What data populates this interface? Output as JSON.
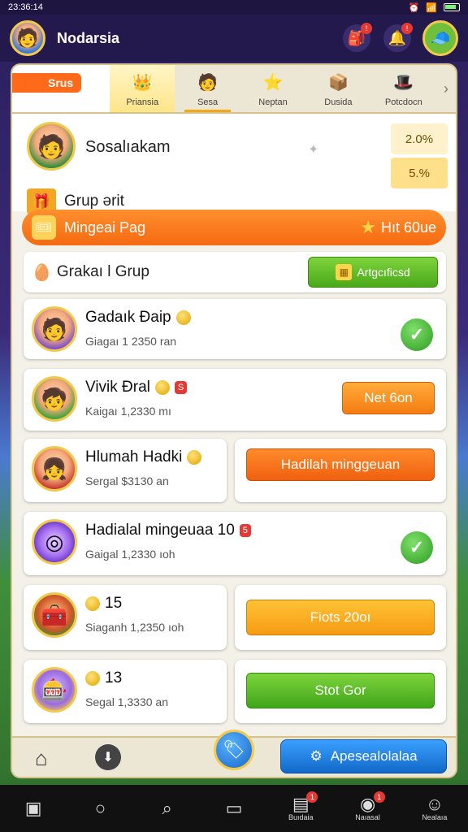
{
  "status": {
    "time": "23:36:14"
  },
  "topbar": {
    "username": "Nodarsia",
    "notif_count_1": "!",
    "notif_count_2": "!"
  },
  "tabs": {
    "first_label": "Srus",
    "items": [
      {
        "label": "Priansia",
        "icon": "crown-icon"
      },
      {
        "label": "Sesa",
        "icon": "character-icon"
      },
      {
        "label": "Neptan",
        "icon": "star-icon"
      },
      {
        "label": "Dusida",
        "icon": "chest-icon"
      },
      {
        "label": "Potcdocn",
        "icon": "hat-icon"
      }
    ]
  },
  "profile": {
    "name": "Sosalıakam",
    "group_label": "Grup ərit",
    "stat_1": "2.0%",
    "stat_2": "5.%"
  },
  "banner": {
    "left_text": "Mingeai Pag",
    "right_text": "Hıt 60ue"
  },
  "group_header": {
    "title": "Grakaı l Grup",
    "button": "Artgcıficsd"
  },
  "rows": [
    {
      "title": "Gadaık Ðaip",
      "sub": "Giagaı 1 2350 ran"
    },
    {
      "title": "Vivik Ðral",
      "sub": "Kaigaı 1,2330 mı",
      "badge": "S",
      "button": "Net 6on"
    },
    {
      "title": "Hlumah Hadki",
      "sub": "Sergal $3130 an",
      "button": "Hadilah minggeuan"
    },
    {
      "title": "Hadialal mingeuaa 10",
      "sub": "Gaigal 1,2330 ıoh",
      "badge": "5"
    },
    {
      "title": "15",
      "sub": "Siaganh 1,2350 ıoh",
      "button": "Fiots 20oı"
    },
    {
      "title": "13",
      "sub": "Segal 1,3330 an",
      "button": "Stot Gor"
    }
  ],
  "bottom": {
    "blue_button": "Apesealolalaa"
  },
  "navbar": {
    "items": [
      {
        "label": "",
        "icon": "square-icon"
      },
      {
        "label": "",
        "icon": "circle-icon"
      },
      {
        "label": "",
        "icon": "search-icon"
      },
      {
        "label": "",
        "icon": "wallet-icon"
      },
      {
        "label": "Buıdaia",
        "icon": "inbox-icon",
        "badge": "1"
      },
      {
        "label": "Naıasal",
        "icon": "target-icon",
        "badge": "1"
      },
      {
        "label": "Nealaıa",
        "icon": "profile-icon"
      }
    ]
  }
}
